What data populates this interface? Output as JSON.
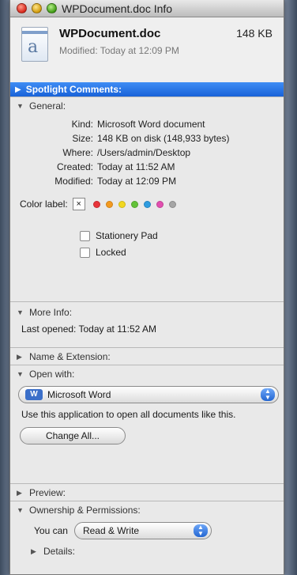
{
  "window": {
    "title": "WPDocument.doc Info"
  },
  "header": {
    "name": "WPDocument.doc",
    "size": "148 KB",
    "modified": "Modified: Today at 12:09 PM",
    "icon_letter": "a"
  },
  "spotlight": {
    "label": "Spotlight Comments:"
  },
  "general": {
    "label": "General:",
    "rows": [
      {
        "key": "Kind:",
        "value": "Microsoft Word document"
      },
      {
        "key": "Size:",
        "value": "148 KB on disk (148,933 bytes)"
      },
      {
        "key": "Where:",
        "value": "/Users/admin/Desktop"
      },
      {
        "key": "Created:",
        "value": "Today at 11:52 AM"
      },
      {
        "key": "Modified:",
        "value": "Today at 12:09 PM"
      }
    ],
    "color_label": "Color label:",
    "color_box": "×",
    "colors": [
      "#e8343a",
      "#f49a20",
      "#f2d820",
      "#62c238",
      "#2e9ce0",
      "#e24fb0",
      "#a5a5a5"
    ],
    "stationery": "Stationery Pad",
    "locked": "Locked"
  },
  "more_info": {
    "label": "More Info:",
    "last_opened": "Last opened: Today at 11:52 AM"
  },
  "name_ext": {
    "label": "Name & Extension:"
  },
  "open_with": {
    "label": "Open with:",
    "app": "Microsoft Word",
    "app_icon": "W",
    "desc": "Use this application to open all documents like this.",
    "change_all": "Change All..."
  },
  "preview": {
    "label": "Preview:"
  },
  "ownership": {
    "label": "Ownership & Permissions:",
    "you_can": "You can",
    "permission": "Read & Write",
    "details": "Details:"
  }
}
